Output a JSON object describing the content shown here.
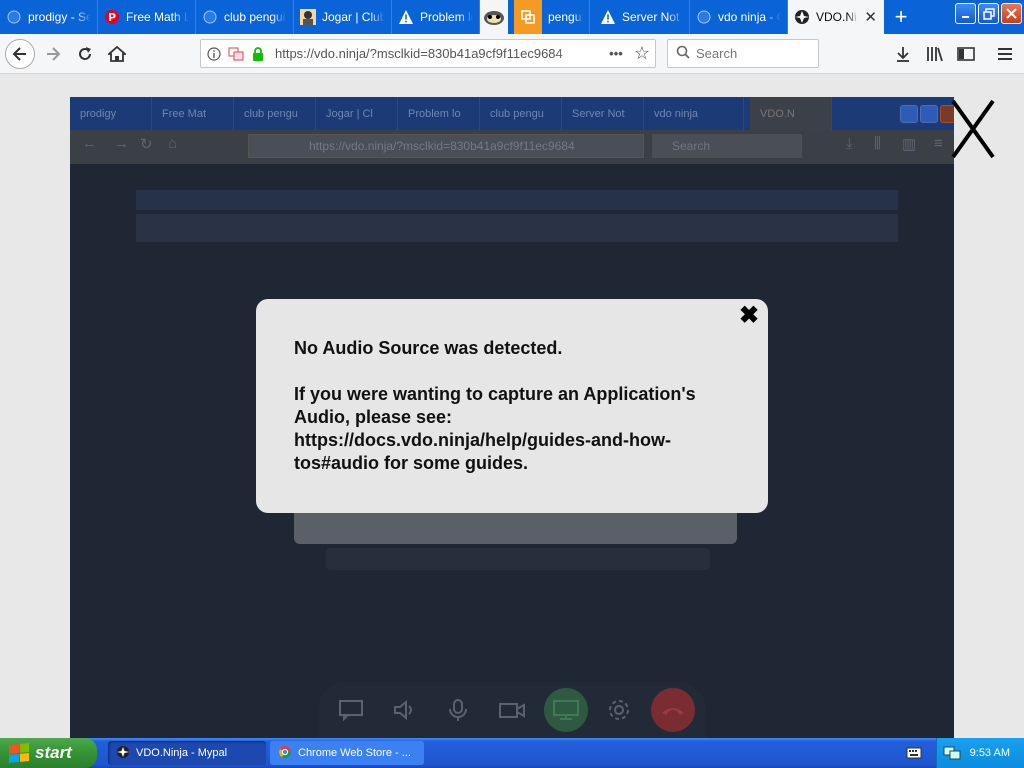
{
  "browser": {
    "tabs": [
      {
        "label": "prodigy - Se",
        "icon": "blue-circle-icon"
      },
      {
        "label": "Free Math L",
        "icon": "pinterest-icon"
      },
      {
        "label": "club pengui",
        "icon": "blue-circle-icon"
      },
      {
        "label": "Jogar | Club",
        "icon": "avatar-icon"
      },
      {
        "label": "Problem loa",
        "icon": "warning-icon"
      },
      {
        "label": "pengui",
        "icon": "orange-extension-icon"
      },
      {
        "label": "Server Not",
        "icon": "warning-icon"
      },
      {
        "label": "vdo ninja - C",
        "icon": "blue-circle-icon"
      },
      {
        "label": "VDO.Ninja",
        "icon": "ninja-icon",
        "active": true
      }
    ],
    "new_tab_label": "+",
    "url": "https://vdo.ninja/?msclkid=830b41a9cf9f11ec9684",
    "search_placeholder": "Search"
  },
  "embedded_screenshot": {
    "tabs": [
      "prodigy",
      "Free Mat",
      "club pengu",
      "Jogar | Cl",
      "Problem lo",
      "club pengu",
      "Server Not",
      "vdo ninja",
      "VDO.N"
    ],
    "url": "https://vdo.ninja/?msclkid=830b41a9cf9f11ec9684",
    "search": "Search"
  },
  "modal": {
    "line1": "No Audio Source was detected.",
    "line2": "If you were wanting to capture an Application's",
    "line3": "Audio, please see:",
    "line4": "https://docs.vdo.ninja/help/guides-and-how-",
    "line5": "tos#audio for some guides.",
    "close_glyph": "✖"
  },
  "taskbar": {
    "start_label": "start",
    "items": [
      {
        "label": "VDO.Ninja - Mypal",
        "active": true
      },
      {
        "label": "Chrome Web Store - ...",
        "active": false
      }
    ],
    "clock": "9:53 AM"
  },
  "colors": {
    "tabstrip": "#0a64d8",
    "toolbar": "#f5f6f7",
    "modal_bg": "#e6e6e6",
    "screen_bg": "#1f2734",
    "taskbar": "#245edb",
    "start_green": "#389838"
  }
}
